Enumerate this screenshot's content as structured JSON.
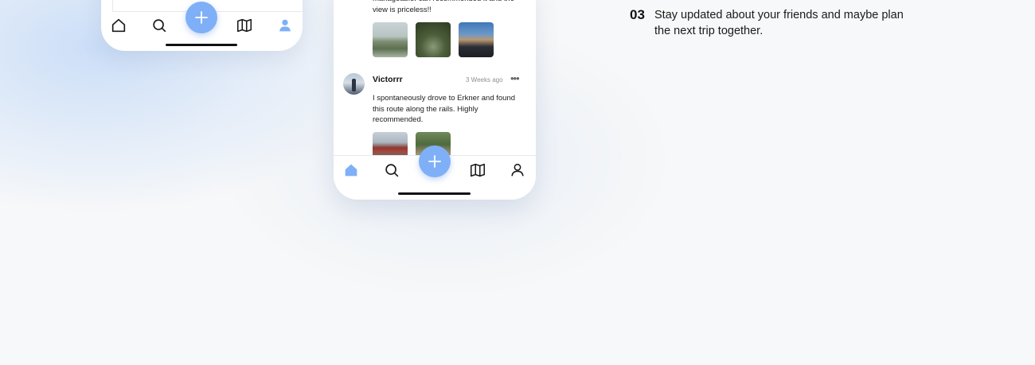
{
  "colors": {
    "accent": "#7fb0f7",
    "active_icon": "#7fb0f7",
    "inactive_icon": "#1a1a1a"
  },
  "phone_left": {
    "nav": [
      {
        "icon": "home-icon",
        "active": false
      },
      {
        "icon": "search-icon",
        "active": false
      },
      {
        "icon": "plus-icon",
        "active": false
      },
      {
        "icon": "map-icon",
        "active": false
      },
      {
        "icon": "profile-icon",
        "active": true
      }
    ]
  },
  "phone_middle": {
    "post1": {
      "text_tail": "manageable. can recommended it and the view is priceless!!",
      "photos": [
        "lake-photo",
        "forest-path-photo",
        "bike-city-photo"
      ]
    },
    "post2": {
      "author": "Victorrr",
      "time": "3 Weeks ago",
      "more": "•••",
      "text": "I spontaneously drove to Erkner and found this route along the rails. Highly recommended.",
      "photos": [
        "train-photo",
        "rails-photo"
      ]
    },
    "nav": [
      {
        "icon": "home-icon",
        "active": true
      },
      {
        "icon": "search-icon",
        "active": false
      },
      {
        "icon": "plus-icon",
        "active": false
      },
      {
        "icon": "map-icon",
        "active": false
      },
      {
        "icon": "profile-icon",
        "active": false
      }
    ]
  },
  "feature": {
    "number": "03",
    "description": "Stay updated about your friends and maybe plan the next trip together."
  }
}
